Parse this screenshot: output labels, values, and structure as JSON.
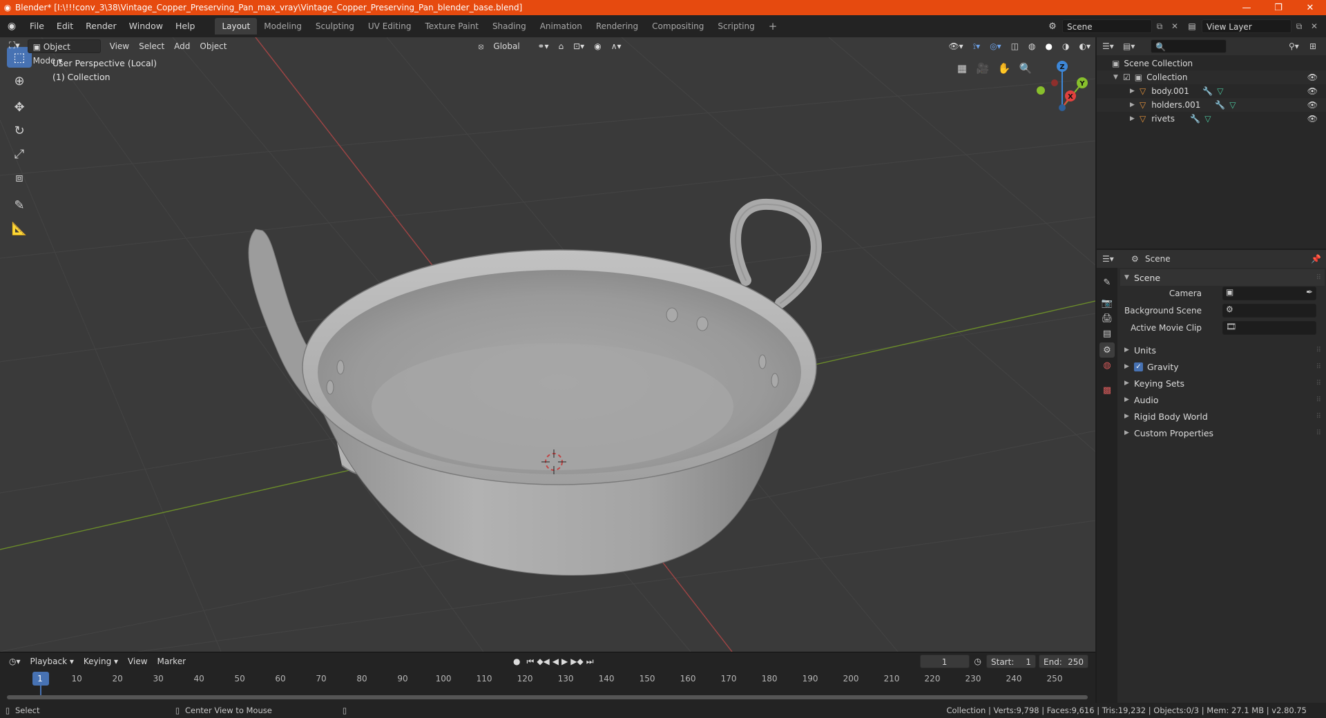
{
  "window": {
    "title": "Blender* [I:\\!!!conv_3\\38\\Vintage_Copper_Preserving_Pan_max_vray\\Vintage_Copper_Preserving_Pan_blender_base.blend]",
    "minimize": "—",
    "maximize": "❐",
    "close": "✕"
  },
  "menubar": {
    "items": [
      "File",
      "Edit",
      "Render",
      "Window",
      "Help"
    ]
  },
  "workspaces": {
    "tabs": [
      "Layout",
      "Modeling",
      "Sculpting",
      "UV Editing",
      "Texture Paint",
      "Shading",
      "Animation",
      "Rendering",
      "Compositing",
      "Scripting"
    ],
    "active": "Layout",
    "add": "+"
  },
  "scene_selector": {
    "value": "Scene"
  },
  "view_layer_selector": {
    "value": "View Layer"
  },
  "viewport": {
    "mode": "Object Mode",
    "menus": [
      "View",
      "Select",
      "Add",
      "Object"
    ],
    "transform_orientation": "Global",
    "overlay_line1": "User Perspective (Local)",
    "overlay_line2": "(1) Collection",
    "gizmo": {
      "x": "X",
      "y": "Y",
      "z": "Z"
    }
  },
  "timeline": {
    "menus": [
      "Playback",
      "Keying",
      "View",
      "Marker"
    ],
    "current_frame": "1",
    "start_label": "Start:",
    "start_value": "1",
    "end_label": "End:",
    "end_value": "250",
    "ticks": [
      "1",
      "10",
      "20",
      "30",
      "40",
      "50",
      "60",
      "70",
      "80",
      "90",
      "100",
      "110",
      "120",
      "130",
      "140",
      "150",
      "160",
      "170",
      "180",
      "190",
      "200",
      "210",
      "220",
      "230",
      "240",
      "250"
    ]
  },
  "statusbar": {
    "left": "Select",
    "middle": "Center View to Mouse",
    "right": "Collection | Verts:9,798 | Faces:9,616 | Tris:19,232 | Objects:0/3 | Mem: 27.1 MB | v2.80.75"
  },
  "outliner": {
    "root": "Scene Collection",
    "collection": "Collection",
    "objects": [
      "body.001",
      "holders.001",
      "rivets"
    ]
  },
  "properties": {
    "header_title": "Scene",
    "panel_title": "Scene",
    "fields": {
      "camera_label": "Camera",
      "background_label": "Background Scene",
      "movieclip_label": "Active Movie Clip"
    },
    "subpanels": [
      "Units",
      "Gravity",
      "Keying Sets",
      "Audio",
      "Rigid Body World",
      "Custom Properties"
    ],
    "gravity_checked": true
  },
  "colors": {
    "title_bar": "#e64a0f",
    "accent_blue": "#4772b3",
    "axis_x": "#e0413e",
    "axis_y": "#87c02c",
    "axis_z": "#3d87d8",
    "object_orange": "#e8953b"
  }
}
